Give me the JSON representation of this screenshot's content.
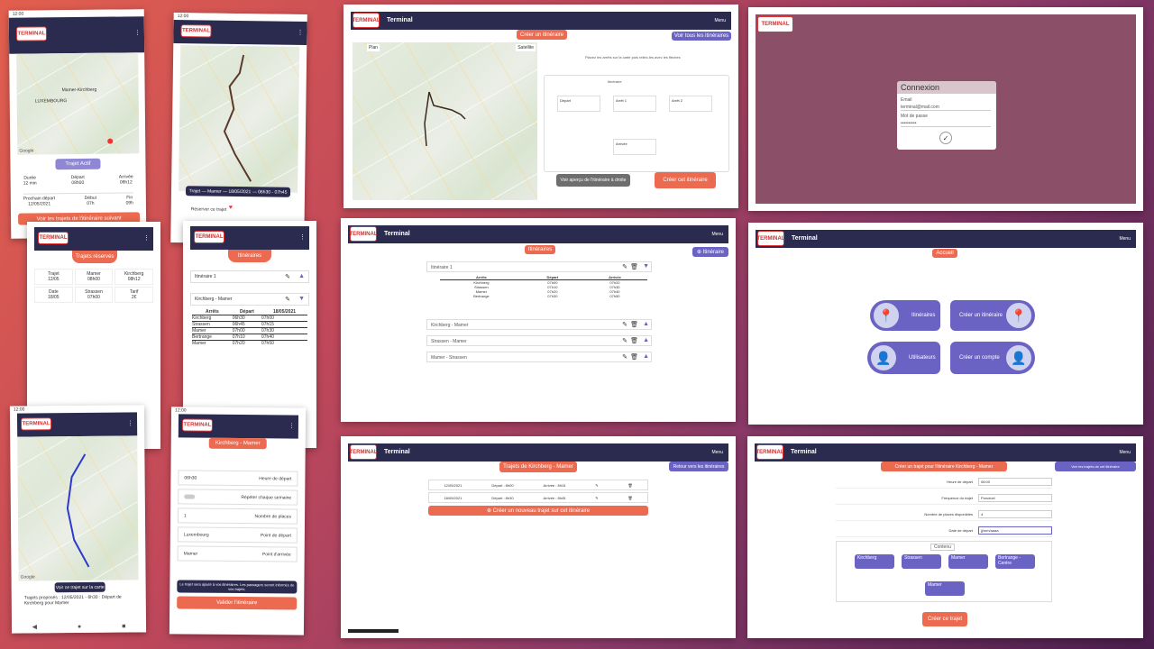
{
  "brand": {
    "logo": "TERMINAL",
    "app_title": "Terminal",
    "menu": "Menu"
  },
  "phone1": {
    "map_label": "Mamer-Kirchberg",
    "place": "LUXEMBOURG",
    "google": "Google",
    "button": "Trajet Actif",
    "stats": [
      {
        "label": "Durée",
        "value": "12 min"
      },
      {
        "label": "Départ",
        "value": "08h00"
      },
      {
        "label": "Arrivée",
        "value": "08h12"
      }
    ],
    "stats2": [
      {
        "label": "Prochain départ",
        "value": "12/05/2021"
      },
      {
        "label": "Début",
        "value": "07h"
      },
      {
        "label": "Fin",
        "value": "09h"
      }
    ],
    "footer_button": "Voir les trajets de l'itinéraire suivant"
  },
  "phone2": {
    "bottom_strip": "Trajet — Mamer — 18/05/2021 — 06h30 - 07h45",
    "reserve": "Réserver ce trajet",
    "fav": "♥"
  },
  "phone3": {
    "title": "Trajets réservés",
    "cells": [
      {
        "a": "Trajet",
        "b": "12/05"
      },
      {
        "a": "Mamer",
        "b": "08h00"
      },
      {
        "a": "Kirchberg",
        "b": "08h12"
      },
      {
        "a": "Date",
        "b": "18/05"
      },
      {
        "a": "Strassen",
        "b": "07h00"
      },
      {
        "a": "Tarif",
        "b": "2€"
      }
    ]
  },
  "phone4": {
    "title": "Itinéraires",
    "items": [
      {
        "name": "Itinéraire 1"
      },
      {
        "name": "Kirchberg - Mamer"
      }
    ],
    "table_headers": [
      "Arrêts",
      "Départ",
      "18/05/2021"
    ],
    "rows": [
      [
        "Kirchberg",
        "06h30",
        "07h00"
      ],
      [
        "Strassen",
        "06h45",
        "07h15"
      ],
      [
        "Mamer",
        "07h00",
        "07h30"
      ],
      [
        "Bertrange",
        "07h10",
        "07h40"
      ],
      [
        "Mamer",
        "07h20",
        "07h50"
      ]
    ]
  },
  "phone5": {
    "google": "Google",
    "button": "Voir ce trajet sur la carte",
    "note": "Trajets proposés : 12/05/2021 - 6h30 : Départ de Kirchberg pour Mamer"
  },
  "phone6": {
    "chips": [
      "Kirchberg",
      "Mamer"
    ],
    "rows": [
      {
        "l": "06h30",
        "r": "Heure de départ"
      },
      {
        "l": "",
        "r": "Répéter chaque semaine"
      },
      {
        "l": "1",
        "r": "Nombre de places"
      },
      {
        "l": "Luxembourg",
        "r": "Point de départ"
      },
      {
        "l": "Mamer",
        "r": "Point d'arrivée"
      }
    ],
    "note": "Le trajet sera ajouté à vos itinéraires. Les passagers seront informés de vos trajets.",
    "button": "Valider l'itinéraire"
  },
  "s1": {
    "tab": "Créer un itinéraire",
    "back": "Voir tous les itinéraires",
    "map_type": "Plan",
    "sat": "Satellite",
    "hint": "Placez les arrêts sur la carte puis reliez-les avec les flèches",
    "panel_title": "Itinéraire",
    "stops": [
      "Départ",
      "Arrêt 1",
      "Arrêt 2",
      "Arrivée"
    ],
    "preview": "Voir aperçu de l'itinéraire à droite",
    "create": "Créer cet itinéraire"
  },
  "s2": {
    "title": "Connexion",
    "email_label": "Email",
    "email_value": "terminal@mail.com",
    "pwd_label": "Mot de passe",
    "pwd_value": "••••••••••"
  },
  "s3": {
    "tab": "Itinéraires",
    "new": "Itinéraire",
    "items": [
      "Itinéraire 1",
      "Kirchberg - Mamer",
      "Strassen - Mamer",
      "Mamer - Strassen"
    ],
    "headers": [
      "Arrêts",
      "Départ",
      "Arrivée"
    ],
    "rows": [
      [
        "Kirchberg",
        "07h00",
        "07h20"
      ],
      [
        "Strassen",
        "07h10",
        "07h30"
      ],
      [
        "Mamer",
        "07h20",
        "07h40"
      ],
      [
        "Bertrange",
        "07h30",
        "07h50"
      ]
    ]
  },
  "s4": {
    "tab": "Accueil",
    "tiles": [
      "Itinéraires",
      "Créer un itinéraire",
      "Utilisateurs",
      "Créer un compte"
    ]
  },
  "s5": {
    "tab": "Trajets de Kirchberg - Mamer",
    "back": "Retour vers les itinéraires",
    "rows": [
      [
        "12/05/2021",
        "Départ : 8h00",
        "Arrivée : 8h15"
      ],
      [
        "18/05/2021",
        "Départ : 8h30",
        "Arrivée : 8h45"
      ]
    ],
    "add": "Créer un nouveau trajet sur cet itinéraire",
    "footer": ""
  },
  "s6": {
    "tab": "Créer un trajet pour l'itinéraire Kirchberg - Mamer",
    "back": "Voir les trajets de cet itinéraire",
    "fields": [
      {
        "l": "Heure de départ",
        "v": "08:00"
      },
      {
        "l": "Fréquence du trajet",
        "v": "Ponctuel"
      },
      {
        "l": "Nombre de places disponibles",
        "v": "4"
      },
      {
        "l": "Date de départ",
        "v": "jj/mm/aaaa"
      }
    ],
    "zoom": "Contenu",
    "stops": [
      "Kirchberg",
      "Strassen",
      "Mamer",
      "Bertrange - Centre",
      "Mamer"
    ],
    "create": "Créer ce trajet"
  }
}
